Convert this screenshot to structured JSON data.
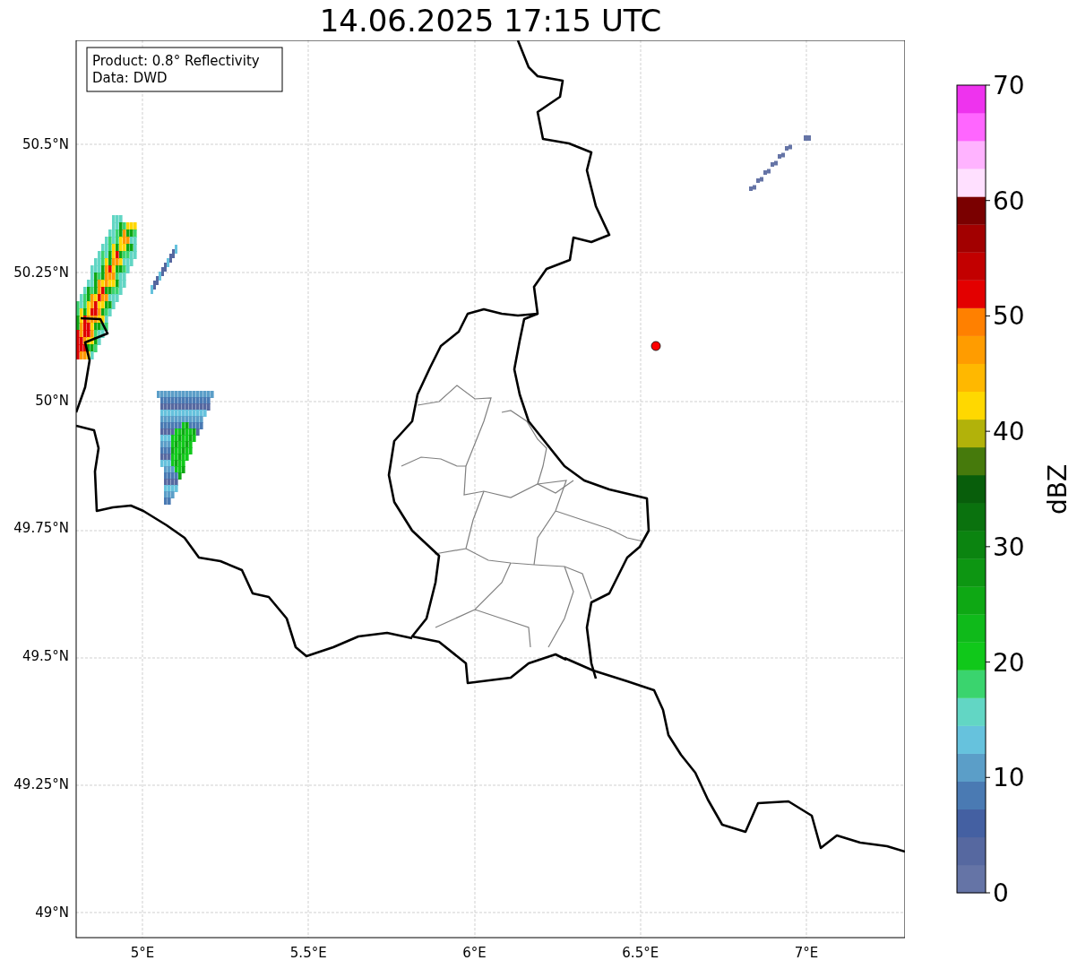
{
  "title": "14.06.2025 17:15 UTC",
  "map": {
    "legend": [
      "Product: 0.8° Reflectivity",
      "Data: DWD"
    ],
    "yticks": [
      "50.5°N",
      "50.25°N",
      "50°N",
      "49.75°N",
      "49.5°N",
      "49.25°N",
      "49°N"
    ],
    "xticks": [
      "5°E",
      "5.5°E",
      "6°E",
      "6.5°E",
      "7°E"
    ]
  },
  "colorbar": {
    "label": "dBZ",
    "ticks": [
      "70",
      "60",
      "50",
      "40",
      "30",
      "20",
      "10",
      "0"
    ],
    "segments": [
      {
        "color": "#6574a6"
      },
      {
        "color": "#5668a0"
      },
      {
        "color": "#4460a2"
      },
      {
        "color": "#4a7ab3"
      },
      {
        "color": "#5b9ec8"
      },
      {
        "color": "#66c2dd"
      },
      {
        "color": "#62d6c4"
      },
      {
        "color": "#3ad46e"
      },
      {
        "color": "#10c81a"
      },
      {
        "color": "#0fba1a"
      },
      {
        "color": "#0ea814"
      },
      {
        "color": "#0d9612"
      },
      {
        "color": "#0b8410"
      },
      {
        "color": "#0a720e"
      },
      {
        "color": "#085e0b"
      },
      {
        "color": "#467a0c"
      },
      {
        "color": "#b2b20a"
      },
      {
        "color": "#ffd800"
      },
      {
        "color": "#ffb800"
      },
      {
        "color": "#ff9c00"
      },
      {
        "color": "#ff8000"
      },
      {
        "color": "#e30000"
      },
      {
        "color": "#c20000"
      },
      {
        "color": "#a20000"
      },
      {
        "color": "#7a0000"
      },
      {
        "color": "#ffe0ff"
      },
      {
        "color": "#ffb3ff"
      },
      {
        "color": "#ff66ff"
      },
      {
        "color": "#ee33ee"
      }
    ]
  }
}
